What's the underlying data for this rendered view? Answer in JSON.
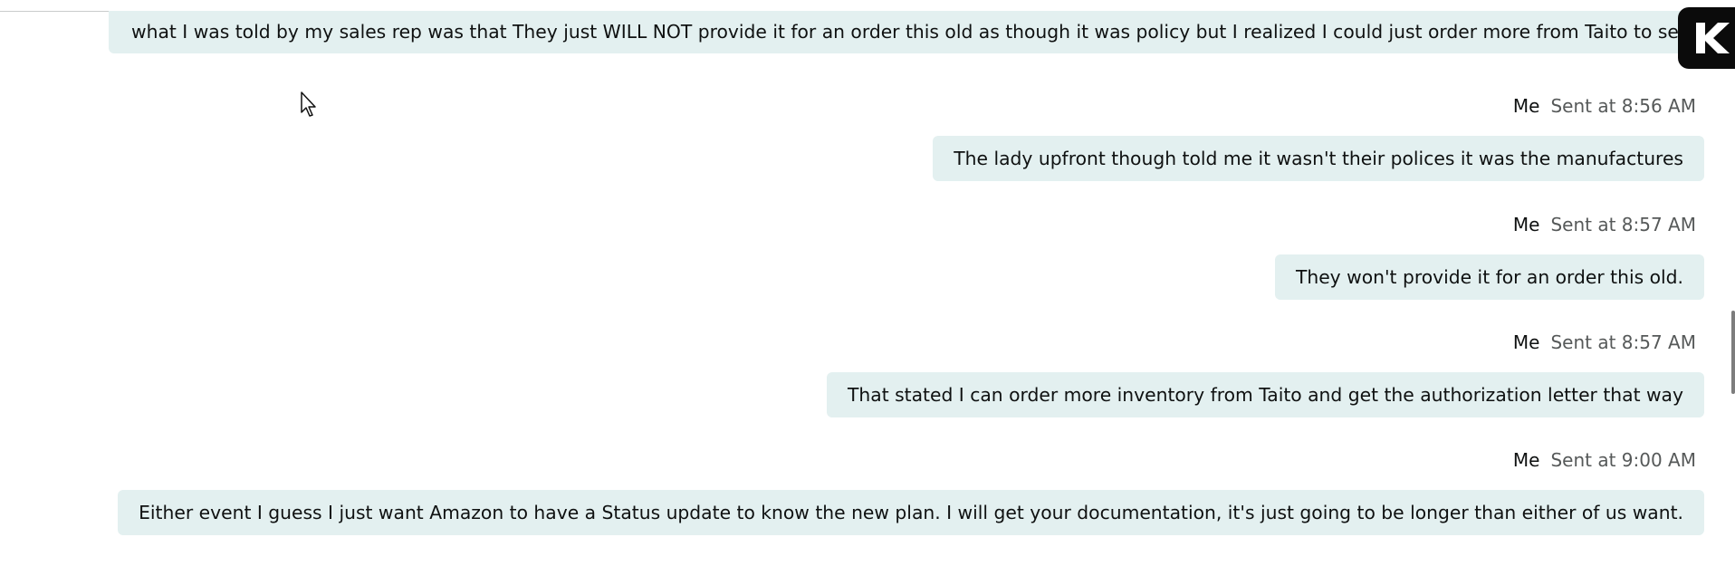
{
  "top_fragment": "...",
  "first_message": "what I was told by my sales rep was that They just WILL NOT provide it for an order this old as though it was policy but I realized I could just order more from Taito to secure it just, not right away",
  "messages": [
    {
      "sender": "Me",
      "time": "Sent at 8:56 AM",
      "text": "The lady upfront though told me it wasn't their polices it was the manufactures"
    },
    {
      "sender": "Me",
      "time": "Sent at 8:57 AM",
      "text": "They won't provide it for an order this old."
    },
    {
      "sender": "Me",
      "time": "Sent at 8:57 AM",
      "text": "That stated I can order more inventory from Taito and get the authorization letter that way"
    },
    {
      "sender": "Me",
      "time": "Sent at 9:00 AM",
      "text": "Either event I guess I just want Amazon to have a Status update to know the new plan. I will get your documentation, it's just going to be longer than either of us want."
    }
  ],
  "icons": {
    "app_badge": "k-logo-icon",
    "cursor": "mouse-pointer-icon"
  },
  "colors": {
    "bubble_bg": "#e3f0f0",
    "time_text": "#565959",
    "badge_bg": "#0b0b0b"
  }
}
